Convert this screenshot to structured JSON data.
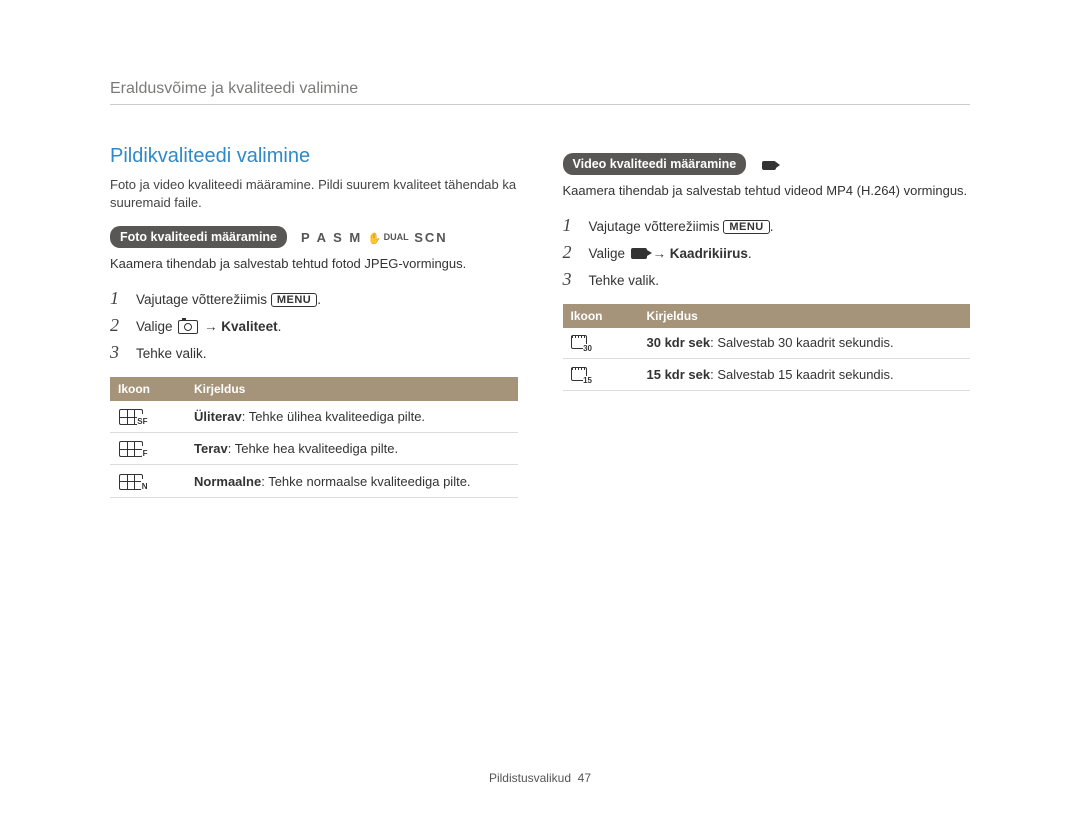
{
  "header": "Eraldusvõime ja kvaliteedi valimine",
  "title": "Pildikvaliteedi valimine",
  "intro": "Foto ja video kvaliteedi määramine. Pildi suurem kvaliteet tähendab ka suuremaid faile.",
  "left": {
    "pill": "Foto kvaliteedi määramine",
    "modes": [
      "P",
      "A",
      "S",
      "M"
    ],
    "modes_suffix": "SCN",
    "modes_dual": "DUAL",
    "body": "Kaamera tihendab ja salvestab tehtud fotod JPEG-vormingus.",
    "steps": [
      {
        "pre": "Vajutage võtterežiimis ",
        "menu": "MENU",
        "post": "."
      },
      {
        "pre": "Valige ",
        "tail_bold": " → Kvaliteet",
        "post": "."
      },
      {
        "pre": "Tehke valik.",
        "post": ""
      }
    ],
    "table": {
      "h1": "Ikoon",
      "h2": "Kirjeldus",
      "rows": [
        {
          "sub": "SF",
          "bold": "Üliterav",
          "rest": ": Tehke ülihea kvaliteediga pilte."
        },
        {
          "sub": "F",
          "bold": "Terav",
          "rest": ": Tehke hea kvaliteediga pilte."
        },
        {
          "sub": "N",
          "bold": "Normaalne",
          "rest": ": Tehke normaalse kvaliteediga pilte."
        }
      ]
    }
  },
  "right": {
    "pill": "Video kvaliteedi määramine",
    "body": "Kaamera tihendab ja salvestab tehtud videod MP4 (H.264) vormingus.",
    "steps": [
      {
        "pre": "Vajutage võtterežiimis ",
        "menu": "MENU",
        "post": "."
      },
      {
        "pre": "Valige ",
        "tail_bold": " → Kaadrikiirus",
        "post": "."
      },
      {
        "pre": "Tehke valik.",
        "post": ""
      }
    ],
    "table": {
      "h1": "Ikoon",
      "h2": "Kirjeldus",
      "rows": [
        {
          "sub": "30",
          "bold": "30 kdr sek",
          "rest": ": Salvestab 30 kaadrit sekundis."
        },
        {
          "sub": "15",
          "bold": "15 kdr sek",
          "rest": ": Salvestab 15 kaadrit sekundis."
        }
      ]
    }
  },
  "footer": {
    "section": "Pildistusvalikud",
    "page": "47"
  }
}
